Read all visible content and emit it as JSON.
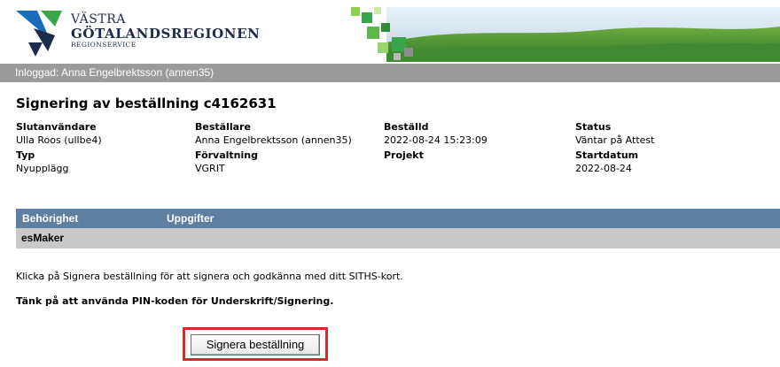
{
  "header": {
    "logo_line1": "VÄSTRA",
    "logo_line2": "GÖTALANDSREGIONEN",
    "logo_line3": "REGIONSERVICE"
  },
  "login_bar": {
    "text": "Inloggad: Anna Engelbrektsson (annen35)"
  },
  "page_title": "Signering av beställning c4162631",
  "order_info": {
    "slutanvandare_label": "Slutanvändare",
    "slutanvandare_value": "Ulla Roos (ullbe4)",
    "bestallare_label": "Beställare",
    "bestallare_value": "Anna Engelbrektsson (annen35)",
    "bestalld_label": "Beställd",
    "bestalld_value": "2022-08-24 15:23:09",
    "status_label": "Status",
    "status_value": "Väntar på Attest",
    "typ_label": "Typ",
    "typ_value": "Nyupplägg",
    "forvaltning_label": "Förvaltning",
    "forvaltning_value": "VGRIT",
    "projekt_label": "Projekt",
    "projekt_value": "",
    "startdatum_label": "Startdatum",
    "startdatum_value": "2022-08-24"
  },
  "table": {
    "headers": [
      "Behörighet",
      "Uppgifter"
    ],
    "rows": [
      {
        "behorighet": "esMaker",
        "uppgifter": ""
      }
    ]
  },
  "instruction_text": "Klicka på Signera beställning för att signera och godkänna med ditt SITHS-kort.",
  "pin_notice": "Tänk på att använda PIN-koden för Underskrift/Signering.",
  "sign_button_label": "Signera beställning",
  "colors": {
    "login_bar": "#9b9b9b",
    "table_header": "#5f7fa1",
    "table_row": "#c9c9c9",
    "highlight_border": "#d7292a",
    "logo_navy": "#1b2b4a",
    "logo_green": "#3aa54a"
  }
}
